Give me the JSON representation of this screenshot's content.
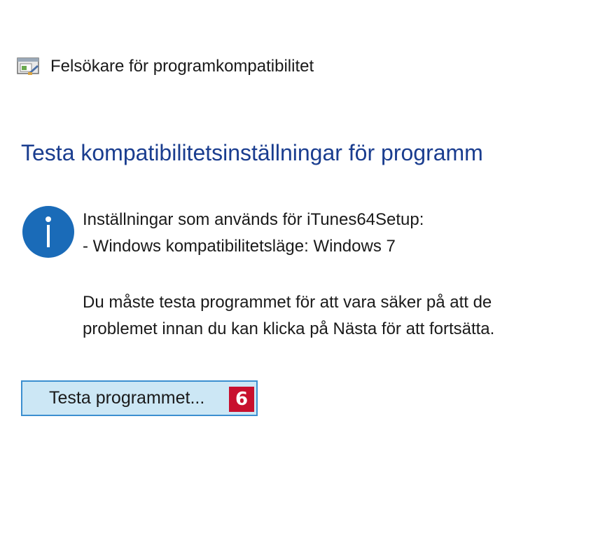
{
  "window": {
    "title": "Felsökare för programkompatibilitet",
    "icon": "compatibility-troubleshooter-icon"
  },
  "main": {
    "heading": "Testa kompatibilitetsinställningar för programm",
    "info_icon": "info-icon",
    "info_lines": [
      "Inställningar som används för iTunes64Setup:",
      "- Windows kompatibilitetsläge: Windows 7",
      "Du måste testa programmet för att vara säker på att de",
      "problemet innan du kan klicka på Nästa för att fortsätta."
    ],
    "test_button_label": "Testa programmet...",
    "step_badge": "6"
  },
  "colors": {
    "heading": "#1a3d8f",
    "info_icon": "#1a6bb8",
    "button_fill": "#cce7f5",
    "button_border": "#3b8fd0",
    "badge": "#c8102e"
  }
}
